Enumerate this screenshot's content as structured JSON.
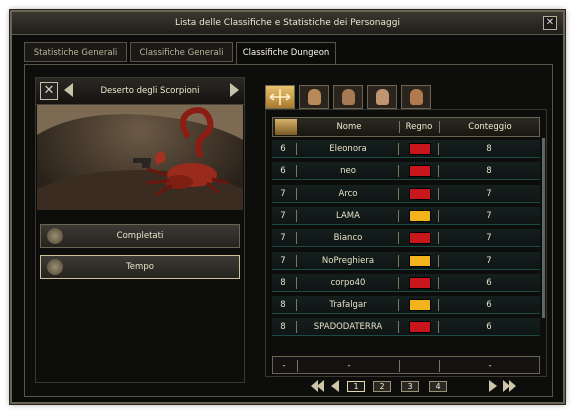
{
  "window": {
    "title": "Lista delle Classifiche e Statistiche dei Personaggi"
  },
  "tabs": [
    {
      "label": "Statistiche Generali"
    },
    {
      "label": "Classifiche Generali"
    },
    {
      "label": "Classifiche Dungeon",
      "active": true
    }
  ],
  "dungeon": {
    "name": "Deserto degli Scorpioni"
  },
  "buttons": {
    "completed": "Completati",
    "time": "Tempo"
  },
  "table": {
    "headers": {
      "name": "Nome",
      "realm": "Regno",
      "count": "Conteggio"
    },
    "rows": [
      {
        "rank": "6",
        "name": "Eleonora",
        "realm_color": "#c8161c",
        "count": "8"
      },
      {
        "rank": "6",
        "name": "neo",
        "realm_color": "#c8161c",
        "count": "8"
      },
      {
        "rank": "7",
        "name": "Arco",
        "realm_color": "#c8161c",
        "count": "7"
      },
      {
        "rank": "7",
        "name": "LAMA",
        "realm_color": "#f2b31d",
        "count": "7"
      },
      {
        "rank": "7",
        "name": "Bianco",
        "realm_color": "#c8161c",
        "count": "7"
      },
      {
        "rank": "7",
        "name": "NoPreghiera",
        "realm_color": "#f2b31d",
        "count": "7"
      },
      {
        "rank": "8",
        "name": "corpo40",
        "realm_color": "#c8161c",
        "count": "6"
      },
      {
        "rank": "8",
        "name": "Trafalgar",
        "realm_color": "#f2b31d",
        "count": "6"
      },
      {
        "rank": "8",
        "name": "SPADODATERRA",
        "realm_color": "#c8161c",
        "count": "6"
      }
    ],
    "self_row": {
      "rank": "-",
      "name": "-",
      "count": "-"
    }
  },
  "pager": {
    "pages": [
      "1",
      "2",
      "3",
      "4"
    ],
    "current": "1"
  }
}
